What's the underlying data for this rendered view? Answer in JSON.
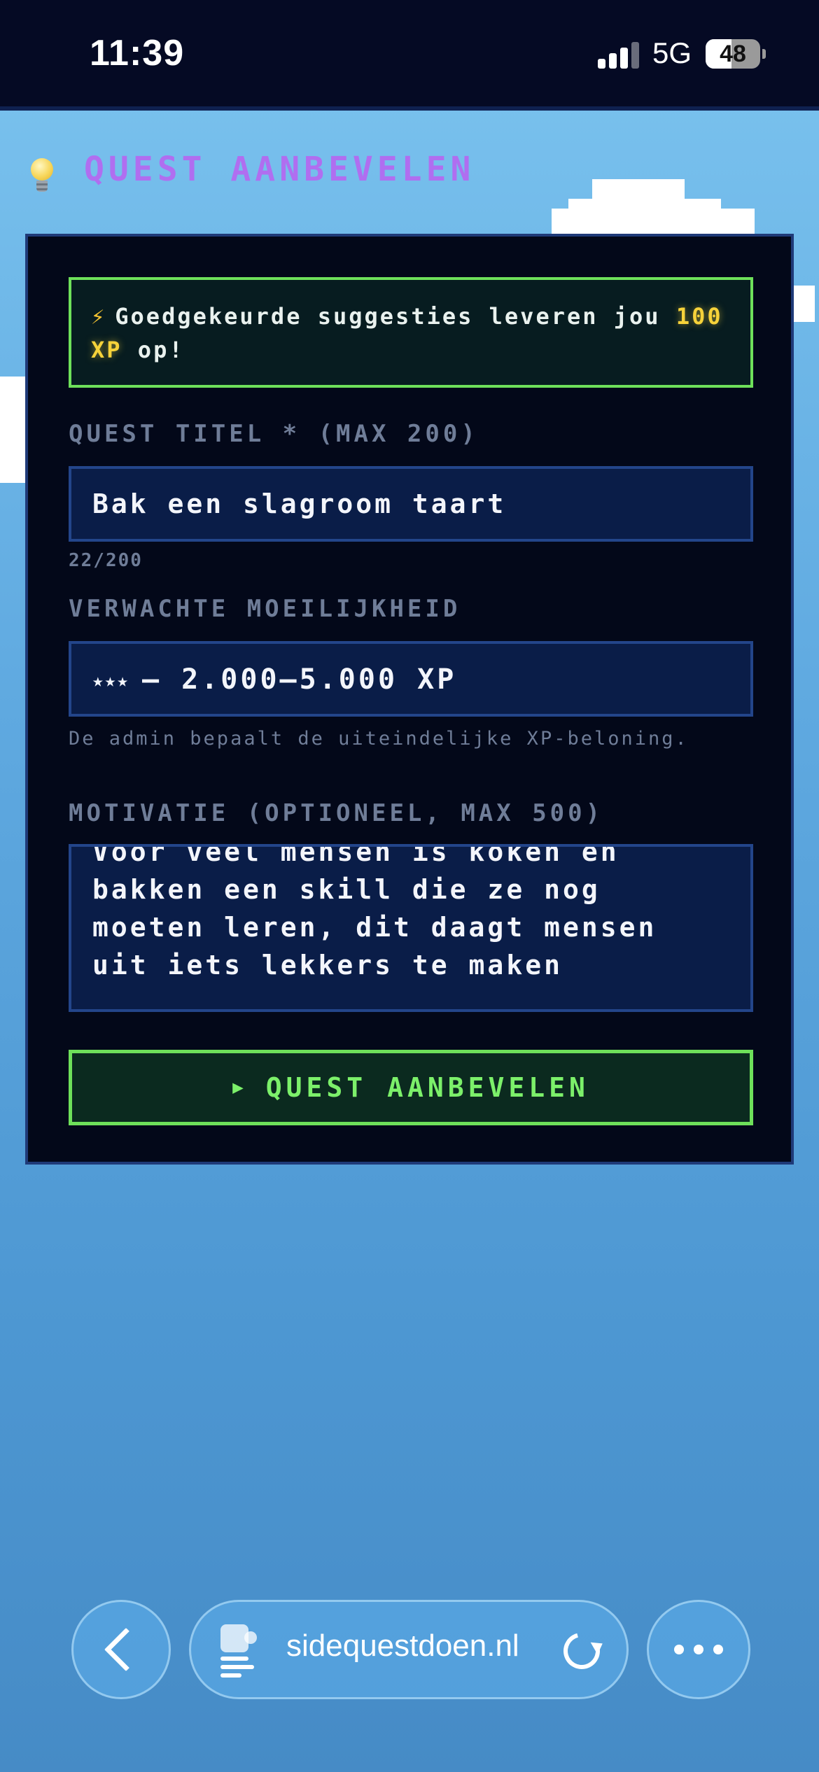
{
  "status_bar": {
    "time": "11:39",
    "network": "5G",
    "battery": "48",
    "battery_level": 0.48
  },
  "header": {
    "icon": "lightbulb-icon",
    "title": "QUEST AANBEVELEN"
  },
  "form": {
    "banner": {
      "icon": "lightning-icon",
      "text_before": "Goedgekeurde suggesties leveren jou ",
      "xp_highlight": "100 XP",
      "text_after": " op!"
    },
    "title_field": {
      "label": "QUEST TITEL * (MAX 200)",
      "value": "Bak een slagroom taart",
      "char_count": "22/200"
    },
    "difficulty_field": {
      "label": "VERWACHTE MOEILIJKHEID",
      "stars": "★★★",
      "value": "— 2.000–5.000 XP",
      "help": "De admin bepaalt de uiteindelijke XP-beloning."
    },
    "motivation_field": {
      "label": "MOTIVATIE (OPTIONEEL, MAX 500)",
      "value": "Voor veel mensen is koken en bakken een skill die ze nog moeten leren, dit daagt mensen uit iets lekkers te maken"
    },
    "submit": {
      "icon": "play-icon",
      "label": "QUEST AANBEVELEN"
    }
  },
  "browser": {
    "url": "sidequestdoen.nl"
  },
  "colors": {
    "accent_purple": "#b06ef0",
    "accent_green": "#6ee05a",
    "xp_gold": "#f6d23a",
    "card_bg": "#030819",
    "field_bg": "#0a1d48"
  }
}
